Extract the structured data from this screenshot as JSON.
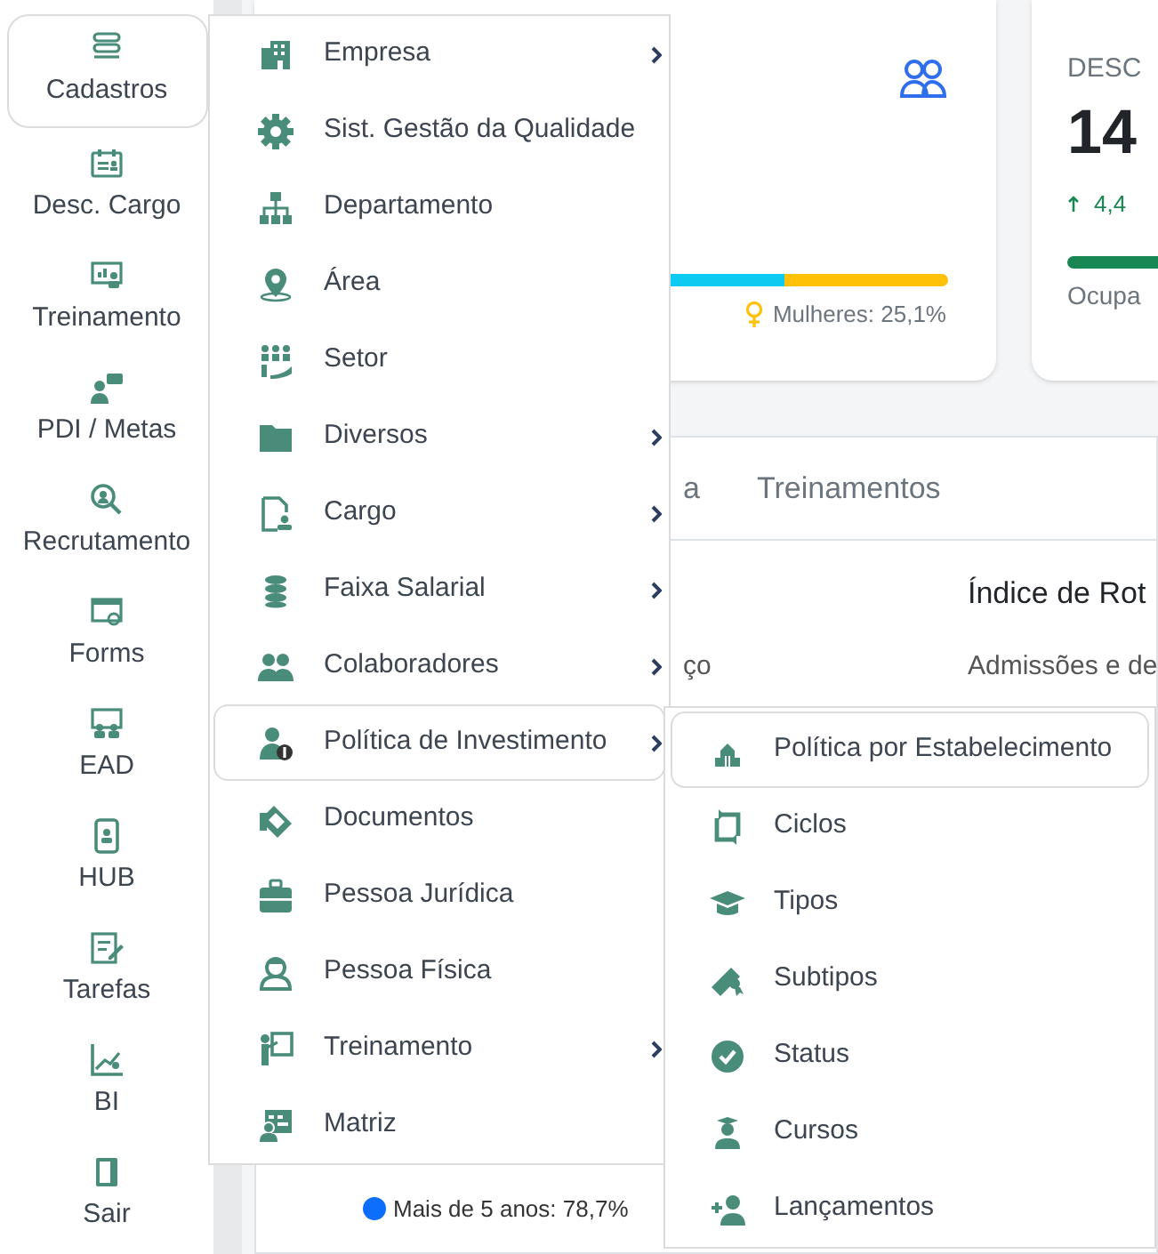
{
  "sidebar": {
    "items": [
      {
        "label": "Cadastros",
        "selected": true
      },
      {
        "label": "Desc. Cargo",
        "selected": false
      },
      {
        "label": "Treinamento",
        "selected": false
      },
      {
        "label": "PDI / Metas",
        "selected": false
      },
      {
        "label": "Recrutamento",
        "selected": false
      },
      {
        "label": "Forms",
        "selected": false
      },
      {
        "label": "EAD",
        "selected": false
      },
      {
        "label": "HUB",
        "selected": false
      },
      {
        "label": "Tarefas",
        "selected": false
      },
      {
        "label": "BI",
        "selected": false
      },
      {
        "label": "Sair",
        "selected": false
      }
    ]
  },
  "cards": [
    {
      "gender_bar": {
        "level": 0.749
      },
      "women": "Mulheres: 25,1%"
    },
    {
      "title": "DESC",
      "value": "14",
      "trend": "4,4",
      "bar": {
        "level": 1
      },
      "caption": "Ocupa"
    }
  ],
  "tabs": [
    {
      "label": "a",
      "selected": false
    },
    {
      "label": "Treinamentos",
      "selected": false
    }
  ],
  "panel": {
    "left_text": "ço",
    "title": "Índice de Rot",
    "subtitle": "Admissões e de",
    "legend": "Mais de 5 anos: 78,7%"
  },
  "menu": {
    "items": [
      {
        "label": "Empresa",
        "submenu": true,
        "selected": false
      },
      {
        "label": "Sist. Gestão da Qualidade",
        "submenu": false,
        "selected": false
      },
      {
        "label": "Departamento",
        "submenu": false,
        "selected": false
      },
      {
        "label": "Área",
        "submenu": false,
        "selected": false
      },
      {
        "label": "Setor",
        "submenu": false,
        "selected": false
      },
      {
        "label": "Diversos",
        "submenu": true,
        "selected": false
      },
      {
        "label": "Cargo",
        "submenu": true,
        "selected": false
      },
      {
        "label": "Faixa Salarial",
        "submenu": true,
        "selected": false
      },
      {
        "label": "Colaboradores",
        "submenu": true,
        "selected": false
      },
      {
        "label": "Política de Investimento",
        "submenu": true,
        "selected": true
      },
      {
        "label": "Documentos",
        "submenu": false,
        "selected": false
      },
      {
        "label": "Pessoa Jurídica",
        "submenu": false,
        "selected": false
      },
      {
        "label": "Pessoa Física",
        "submenu": false,
        "selected": false
      },
      {
        "label": "Treinamento",
        "submenu": true,
        "selected": false
      },
      {
        "label": "Matriz",
        "submenu": false,
        "selected": false
      }
    ]
  },
  "submenu": {
    "items": [
      {
        "label": "Política por Estabelecimento",
        "selected": true
      },
      {
        "label": "Ciclos",
        "selected": false
      },
      {
        "label": "Tipos",
        "selected": false
      },
      {
        "label": "Subtipos",
        "selected": false
      },
      {
        "label": "Status",
        "selected": false
      },
      {
        "label": "Cursos",
        "selected": false
      },
      {
        "label": "Lançamentos",
        "selected": false
      }
    ]
  }
}
